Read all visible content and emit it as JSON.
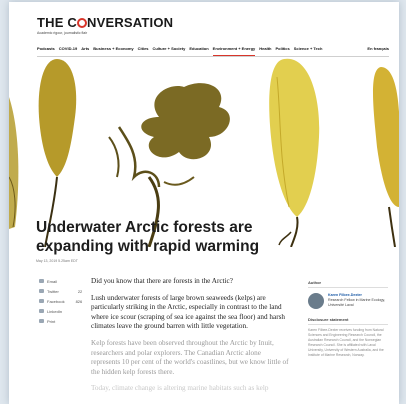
{
  "site": {
    "logo": "THE CONVERSATION",
    "logo_left": "THE C",
    "logo_right": "NVERSATION",
    "tagline": "Academic rigour, journalistic flair"
  },
  "nav": {
    "items": [
      "Podcasts",
      "COVID-19",
      "Arts",
      "Business + Economy",
      "Cities",
      "Culture + Society",
      "Education",
      "Environment + Energy",
      "Health",
      "Politics",
      "Science + Tech"
    ],
    "active": "Environment + Energy",
    "language": "En français"
  },
  "article": {
    "title": "Underwater Arctic forests are expanding with rapid warming",
    "date": "May 13, 2019 5.25am EDT",
    "paragraphs": [
      "Did you know that there are forests in the Arctic?",
      "Lush underwater forests of large brown seaweeds (kelps) are particularly striking in the Arctic, especially in contrast to the land where ice scour (scraping of sea ice against the sea floor) and harsh climates leave the ground barren with little vegetation.",
      "Kelp forests have been observed throughout the Arctic by Inuit, researchers and polar explorers. The Canadian Arctic alone represents 10 per cent of the world's coastlines, but we know little of the hidden kelp forests there.",
      "Today, climate change is altering marine habitats such as kelp"
    ]
  },
  "share": [
    {
      "label": "Email",
      "count": ""
    },
    {
      "label": "Twitter",
      "count": "22"
    },
    {
      "label": "Facebook",
      "count": "826"
    },
    {
      "label": "LinkedIn",
      "count": ""
    },
    {
      "label": "Print",
      "count": ""
    }
  ],
  "sidebar": {
    "author_heading": "Author",
    "author_name": "Karen Filbee-Dexter",
    "author_role": "Research Fellow in Marine Ecology, Université Laval",
    "disclosure_heading": "Disclosure statement",
    "disclosure_text": "Karen Filbee-Dexter receives funding from Natural Sciences and Engineering Research Council, the Australian Research Council, and the Norwegian Research Council. She is affiliated with Laval University, University of Western Australia, and the Institute of Marine Research, Norway."
  },
  "colors": {
    "accent": "#d8352a",
    "link": "#1b5aa6"
  }
}
